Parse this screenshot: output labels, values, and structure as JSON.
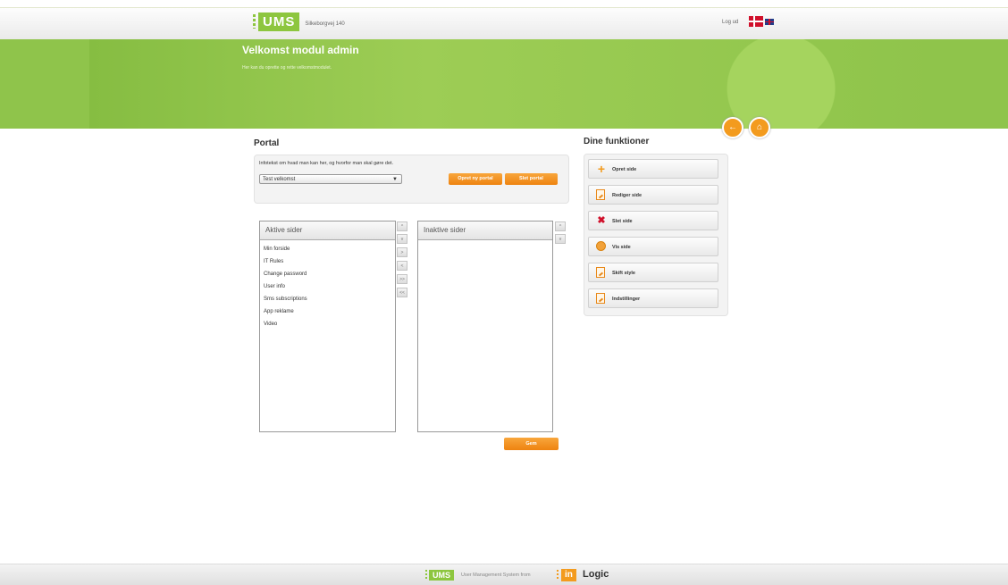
{
  "header": {
    "logo_text": "UMS",
    "address": "Silkeborgvej 140",
    "logout_label": "Log ud"
  },
  "banner": {
    "title": "Velkomst modul admin",
    "subtitle": "Her kan du oprette og rette velkomstmodulet."
  },
  "portal": {
    "title": "Portal",
    "infotext": "Infotekst om hvad man kan her, og hvorfor man skal gøre det.",
    "selected": "Test velkomst",
    "create_label": "Opret ny portal",
    "delete_label": "Slet portal"
  },
  "active": {
    "header": "Aktive sider",
    "items": [
      "Min forside",
      "IT Rules",
      "Change password",
      "User info",
      "Sms subscriptions",
      "App reklame",
      "Video"
    ]
  },
  "inactive": {
    "header": "Inaktive sider"
  },
  "arrows": {
    "up": "^",
    "down": "v",
    "right": ">",
    "left": "<",
    "all_right": ">>",
    "all_left": "<<"
  },
  "save_label": "Gem",
  "functions": {
    "title": "Dine funktioner",
    "items": [
      {
        "label": "Opret side",
        "icon": "plus-icon"
      },
      {
        "label": "Rediger side",
        "icon": "document-edit-icon"
      },
      {
        "label": "Slet side",
        "icon": "delete-x-icon"
      },
      {
        "label": "Vis side",
        "icon": "globe-icon"
      },
      {
        "label": "Skift style",
        "icon": "document-style-icon"
      },
      {
        "label": "Indstillinger",
        "icon": "document-settings-icon"
      }
    ]
  },
  "footer": {
    "ums": "UMS",
    "text": "User Management System from",
    "in": "in",
    "logic": "Logic"
  },
  "colors": {
    "green": "#8fc44b",
    "orange": "#f39b1e"
  }
}
